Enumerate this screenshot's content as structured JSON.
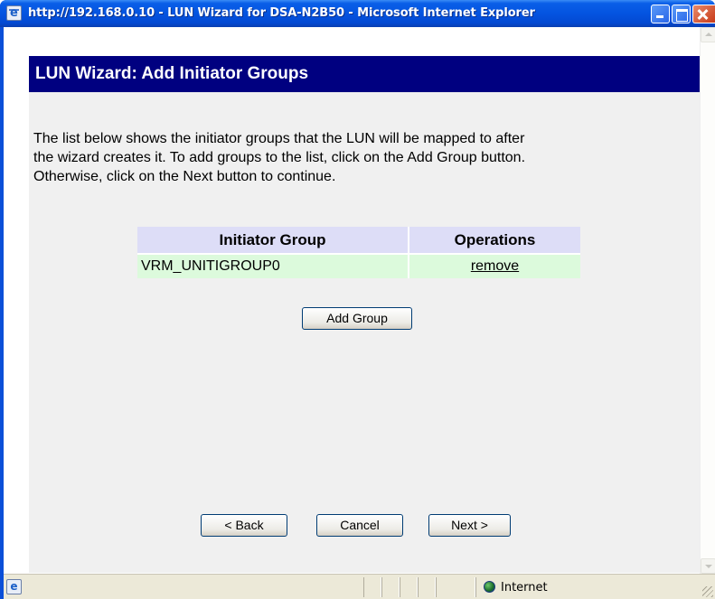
{
  "window": {
    "title": "http://192.168.0.10 - LUN Wizard for DSA-N2B50 - Microsoft Internet Explorer"
  },
  "wizard": {
    "title": "LUN Wizard: Add Initiator Groups",
    "description_lines": [
      "The list below shows the initiator groups that the LUN will be mapped to after",
      "the wizard creates it. To add groups to the list, click on the Add Group button.",
      "Otherwise, click on the Next button to continue."
    ]
  },
  "table": {
    "headers": [
      "Initiator Group",
      "Operations"
    ],
    "rows": [
      {
        "group": "VRM_UNITIGROUP0",
        "operation": "remove"
      }
    ]
  },
  "buttons": {
    "add_group": "Add Group",
    "back": "< Back",
    "cancel": "Cancel",
    "next": "Next >"
  },
  "statusbar": {
    "zone": "Internet"
  },
  "icons": {
    "title": "ie-page-icon",
    "status": "ie-page-icon",
    "zone": "globe-icon"
  }
}
